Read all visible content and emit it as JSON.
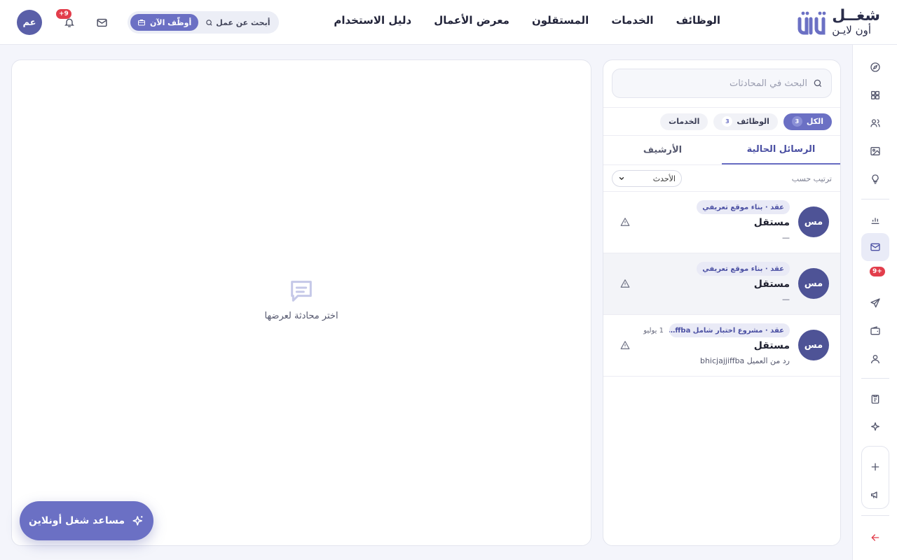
{
  "brand": {
    "line1": "شغــل",
    "line2": "أون لايـن"
  },
  "nav": [
    {
      "label": "الوظائف"
    },
    {
      "label": "الخدمات"
    },
    {
      "label": "المستقلون"
    },
    {
      "label": "معرض الأعمال"
    },
    {
      "label": "دليل الاستخدام"
    }
  ],
  "header": {
    "find_job": "أبحث عن عمل",
    "hire_now": "أوظّف الآن",
    "notifications_badge": "+9",
    "avatar_initials": "عم"
  },
  "rail": {
    "messages_badge": "+9"
  },
  "list": {
    "search_placeholder": "البحث في المحادثات",
    "filters": [
      {
        "label": "الكل",
        "count": "3"
      },
      {
        "label": "الوظائف",
        "count": "3"
      },
      {
        "label": "الخدمات",
        "count": ""
      }
    ],
    "tabs": [
      {
        "label": "الرسائل الحالية"
      },
      {
        "label": "الأرشيف"
      }
    ],
    "sort_label": "ترتيب حسب",
    "sort_value": "الأحدث",
    "conversations": [
      {
        "initials": "مس",
        "tag": "عقد · بناء موقع تعريفي",
        "date": "",
        "name": "مستقل",
        "preview": "—"
      },
      {
        "initials": "مس",
        "tag": "عقد · بناء موقع تعريفي",
        "date": "",
        "name": "مستقل",
        "preview": "—"
      },
      {
        "initials": "مس",
        "tag": "عقد · مشروع اختبار شامل ffba…",
        "date": "1 يوليو",
        "name": "مستقل",
        "preview": "رد من العميل bhicjajjiffba"
      }
    ]
  },
  "chat": {
    "empty_text": "اختر محادثة لعرضها"
  },
  "assistant": {
    "label": "مساعد شغل أونلاين"
  },
  "colors": {
    "accent": "#6b70c4",
    "avatar": "#4e5396",
    "badge": "#e23d4b",
    "logout": "#e23d4b"
  }
}
